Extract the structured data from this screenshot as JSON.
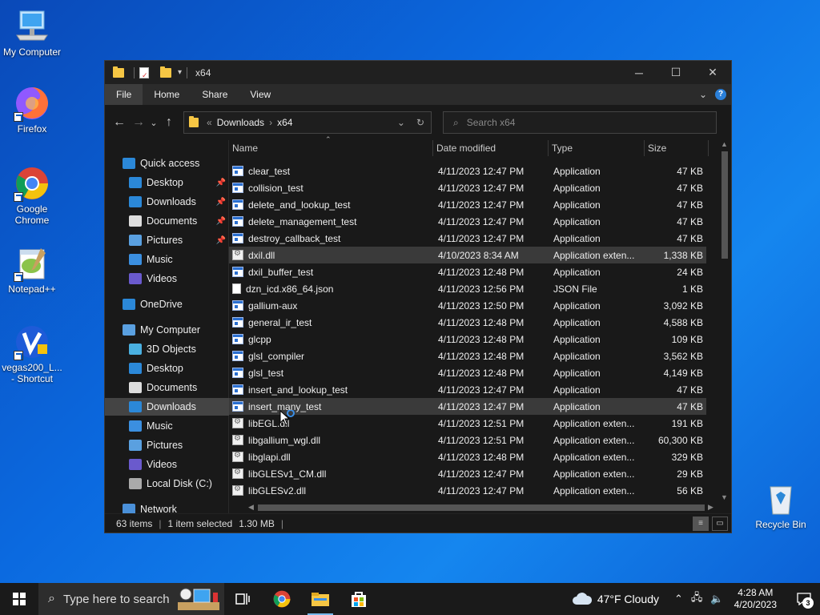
{
  "desktop": {
    "icons": [
      {
        "label": "My Computer"
      },
      {
        "label": "Firefox"
      },
      {
        "label": "Google Chrome"
      },
      {
        "label": "Notepad++"
      },
      {
        "label": "vegas200_L... - Shortcut"
      },
      {
        "label": "Recycle Bin"
      }
    ]
  },
  "window": {
    "title": "x64",
    "ribbon_tabs": [
      "File",
      "Home",
      "Share",
      "View"
    ],
    "help": "?",
    "address": {
      "crumbs": [
        "Downloads",
        "x64"
      ]
    },
    "search": {
      "placeholder": "Search x64"
    }
  },
  "nav": {
    "items": [
      {
        "label": "Quick access",
        "icon": "star-icon",
        "color": "#2b88d8"
      },
      {
        "label": "Desktop",
        "icon": "desktop-icon",
        "color": "#2b88d8",
        "pinned": true
      },
      {
        "label": "Downloads",
        "icon": "download-icon",
        "color": "#2b88d8",
        "pinned": true
      },
      {
        "label": "Documents",
        "icon": "document-icon",
        "color": "#dddddd",
        "pinned": true
      },
      {
        "label": "Pictures",
        "icon": "pictures-icon",
        "color": "#5aa0e0",
        "pinned": true
      },
      {
        "label": "Music",
        "icon": "music-icon",
        "color": "#3b8fe0"
      },
      {
        "label": "Videos",
        "icon": "videos-icon",
        "color": "#6a5acd"
      },
      {
        "label": "OneDrive",
        "icon": "cloud-icon",
        "color": "#2b88d8"
      },
      {
        "label": "My Computer",
        "icon": "computer-icon",
        "color": "#5aa0e0"
      },
      {
        "label": "3D Objects",
        "icon": "cube-icon",
        "color": "#4ab0e0"
      },
      {
        "label": "Desktop",
        "icon": "desktop-icon",
        "color": "#2b88d8"
      },
      {
        "label": "Documents",
        "icon": "document-icon",
        "color": "#dddddd"
      },
      {
        "label": "Downloads",
        "icon": "download-icon",
        "color": "#2b88d8",
        "selected": true
      },
      {
        "label": "Music",
        "icon": "music-icon",
        "color": "#3b8fe0"
      },
      {
        "label": "Pictures",
        "icon": "pictures-icon",
        "color": "#5aa0e0"
      },
      {
        "label": "Videos",
        "icon": "videos-icon",
        "color": "#6a5acd"
      },
      {
        "label": "Local Disk (C:)",
        "icon": "drive-icon",
        "color": "#aaaaaa"
      },
      {
        "label": "Network",
        "icon": "network-icon",
        "color": "#4a90d9"
      }
    ]
  },
  "columns": {
    "name": "Name",
    "date": "Date modified",
    "type": "Type",
    "size": "Size"
  },
  "files": [
    {
      "name": "clear_test",
      "date": "4/11/2023 12:47 PM",
      "type": "Application",
      "size": "47 KB",
      "kind": "app"
    },
    {
      "name": "collision_test",
      "date": "4/11/2023 12:47 PM",
      "type": "Application",
      "size": "47 KB",
      "kind": "app"
    },
    {
      "name": "delete_and_lookup_test",
      "date": "4/11/2023 12:47 PM",
      "type": "Application",
      "size": "47 KB",
      "kind": "app"
    },
    {
      "name": "delete_management_test",
      "date": "4/11/2023 12:47 PM",
      "type": "Application",
      "size": "47 KB",
      "kind": "app"
    },
    {
      "name": "destroy_callback_test",
      "date": "4/11/2023 12:47 PM",
      "type": "Application",
      "size": "47 KB",
      "kind": "app"
    },
    {
      "name": "dxil.dll",
      "date": "4/10/2023 8:34 AM",
      "type": "Application exten...",
      "size": "1,338 KB",
      "kind": "dll",
      "highlighted": true
    },
    {
      "name": "dxil_buffer_test",
      "date": "4/11/2023 12:48 PM",
      "type": "Application",
      "size": "24 KB",
      "kind": "app"
    },
    {
      "name": "dzn_icd.x86_64.json",
      "date": "4/11/2023 12:56 PM",
      "type": "JSON File",
      "size": "1 KB",
      "kind": "json"
    },
    {
      "name": "gallium-aux",
      "date": "4/11/2023 12:50 PM",
      "type": "Application",
      "size": "3,092 KB",
      "kind": "app"
    },
    {
      "name": "general_ir_test",
      "date": "4/11/2023 12:48 PM",
      "type": "Application",
      "size": "4,588 KB",
      "kind": "app"
    },
    {
      "name": "glcpp",
      "date": "4/11/2023 12:48 PM",
      "type": "Application",
      "size": "109 KB",
      "kind": "app"
    },
    {
      "name": "glsl_compiler",
      "date": "4/11/2023 12:48 PM",
      "type": "Application",
      "size": "3,562 KB",
      "kind": "app"
    },
    {
      "name": "glsl_test",
      "date": "4/11/2023 12:48 PM",
      "type": "Application",
      "size": "4,149 KB",
      "kind": "app"
    },
    {
      "name": "insert_and_lookup_test",
      "date": "4/11/2023 12:47 PM",
      "type": "Application",
      "size": "47 KB",
      "kind": "app"
    },
    {
      "name": "insert_many_test",
      "date": "4/11/2023 12:47 PM",
      "type": "Application",
      "size": "47 KB",
      "kind": "app",
      "highlighted": true
    },
    {
      "name": "libEGL.dll",
      "date": "4/11/2023 12:51 PM",
      "type": "Application exten...",
      "size": "191 KB",
      "kind": "dll"
    },
    {
      "name": "libgallium_wgl.dll",
      "date": "4/11/2023 12:51 PM",
      "type": "Application exten...",
      "size": "60,300 KB",
      "kind": "dll"
    },
    {
      "name": "libglapi.dll",
      "date": "4/11/2023 12:48 PM",
      "type": "Application exten...",
      "size": "329 KB",
      "kind": "dll"
    },
    {
      "name": "libGLESv1_CM.dll",
      "date": "4/11/2023 12:47 PM",
      "type": "Application exten...",
      "size": "29 KB",
      "kind": "dll"
    },
    {
      "name": "libGLESv2.dll",
      "date": "4/11/2023 12:47 PM",
      "type": "Application exten...",
      "size": "56 KB",
      "kind": "dll"
    }
  ],
  "status": {
    "count": "63 items",
    "selected": "1 item selected",
    "size": "1.30 MB",
    "sep": "|"
  },
  "taskbar": {
    "search_placeholder": "Type here to search",
    "weather": "47°F  Cloudy",
    "time": "4:28 AM",
    "date": "4/20/2023",
    "notifications": "3"
  }
}
